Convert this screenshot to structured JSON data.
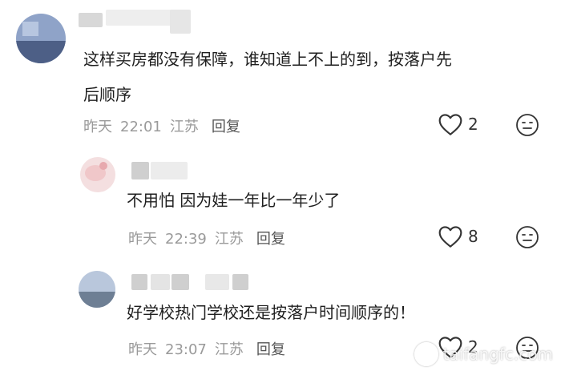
{
  "comments": [
    {
      "text": "这样买房都没有保障，谁知道上不上的到，按落户先后顺序",
      "line1": "这样买房都没有保障，谁知道上不上的到，按落户先",
      "line2": "后顺序",
      "day": "昨天",
      "time": "22:01",
      "location": "江苏",
      "reply_label": "回复",
      "likes": "2",
      "avatar_color": "#8fa3c8"
    },
    {
      "text": "不用怕 因为娃一年比一年少了",
      "day": "昨天",
      "time": "22:39",
      "location": "江苏",
      "reply_label": "回复",
      "likes": "8",
      "avatar_color": "#f4dfe0"
    },
    {
      "text": "好学校热门学校还是按落户时间顺序的！",
      "day": "昨天",
      "time": "23:07",
      "location": "江苏",
      "reply_label": "回复",
      "likes": "2",
      "avatar_color": "#b9c7dc"
    }
  ],
  "icons": {
    "like": "heart-outline-icon",
    "dislike": "frown-face-icon"
  },
  "watermark": {
    "text": "taifangfc.com"
  }
}
